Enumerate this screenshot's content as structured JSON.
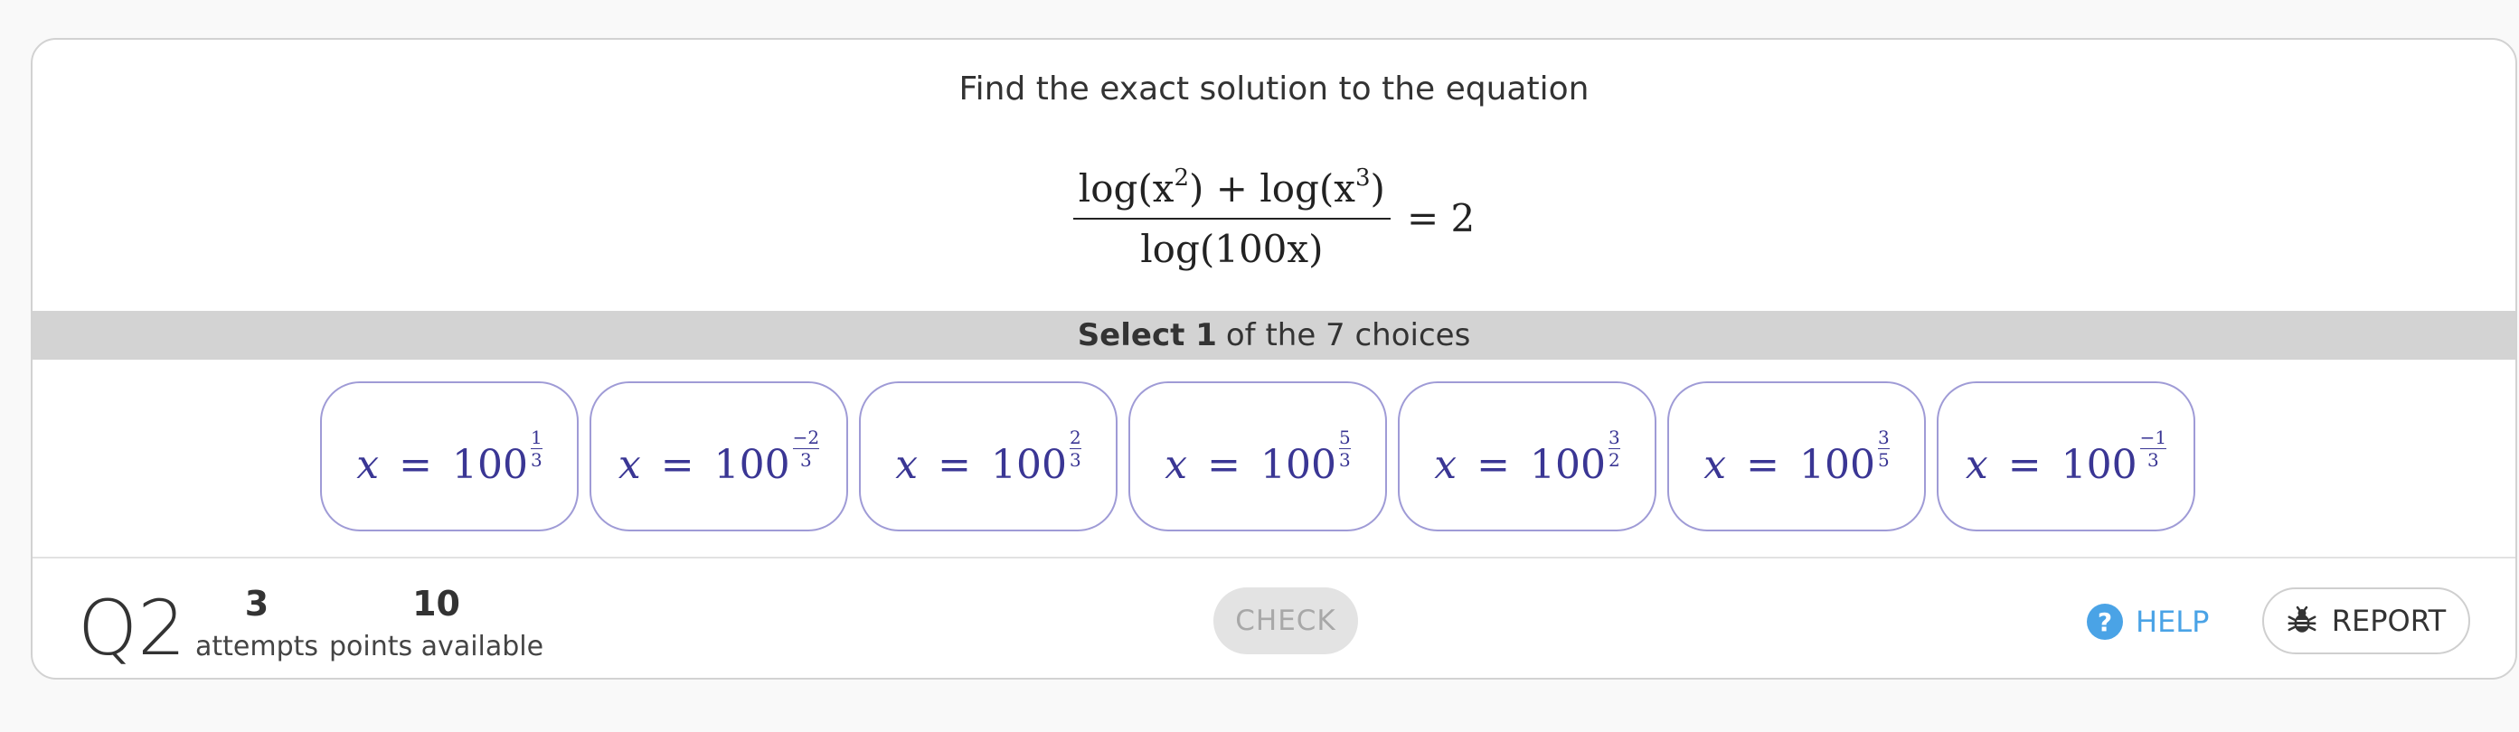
{
  "question": {
    "prompt": "Find the exact solution to the equation",
    "equation": {
      "numerator_a": "log(x",
      "numerator_a_exp": "2",
      "numerator_mid": ") + log(x",
      "numerator_b_exp": "3",
      "numerator_end": ")",
      "denominator": "log(100x)",
      "rhs": "= 2"
    }
  },
  "selection": {
    "bold": "Select 1",
    "rest": "of the 7 choices"
  },
  "choices": [
    {
      "lhs": "x",
      "eq": "=",
      "base": "100",
      "exp_num": "1",
      "exp_den": "3"
    },
    {
      "lhs": "x",
      "eq": "=",
      "base": "100",
      "exp_num": "−2",
      "exp_den": "3"
    },
    {
      "lhs": "x",
      "eq": "=",
      "base": "100",
      "exp_num": "2",
      "exp_den": "3"
    },
    {
      "lhs": "x",
      "eq": "=",
      "base": "100",
      "exp_num": "5",
      "exp_den": "3"
    },
    {
      "lhs": "x",
      "eq": "=",
      "base": "100",
      "exp_num": "3",
      "exp_den": "2"
    },
    {
      "lhs": "x",
      "eq": "=",
      "base": "100",
      "exp_num": "3",
      "exp_den": "5"
    },
    {
      "lhs": "x",
      "eq": "=",
      "base": "100",
      "exp_num": "−1",
      "exp_den": "3"
    }
  ],
  "footer": {
    "question_number": "Q2",
    "attempts_value": "3",
    "attempts_label": "attempts",
    "points_value": "10",
    "points_label": "points available",
    "check_label": "CHECK",
    "help_label": "HELP",
    "help_icon_glyph": "?",
    "report_label": "REPORT"
  },
  "icons": {
    "help": "question-circle-icon",
    "report": "bug-icon"
  },
  "colors": {
    "choice_text": "#3a3694",
    "choice_border": "#9f9bd6",
    "help_blue": "#4aa3e6",
    "select_bar": "#d3d3d3"
  }
}
